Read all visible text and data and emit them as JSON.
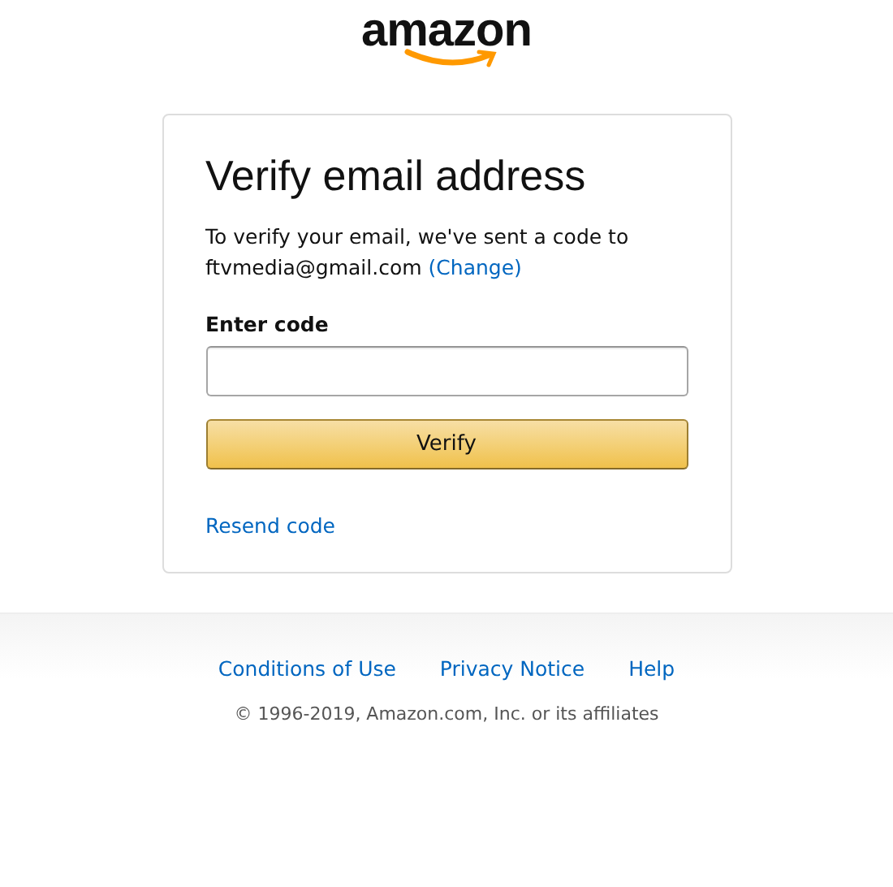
{
  "logo": {
    "text": "amazon"
  },
  "card": {
    "title": "Verify email address",
    "message": "To verify your email, we've sent a code to ftvmedia@gmail.com",
    "change_link": "(Change)",
    "code_field": {
      "label": "Enter code"
    },
    "verify_button": "Verify",
    "resend_link": "Resend code"
  },
  "footer": {
    "links": [
      "Conditions of Use",
      "Privacy Notice",
      "Help"
    ],
    "copyright": "© 1996-2019, Amazon.com, Inc. or its affiliates"
  }
}
